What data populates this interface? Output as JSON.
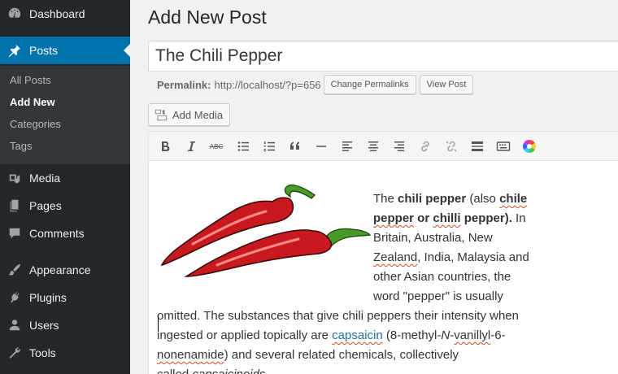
{
  "sidebar": {
    "items": [
      {
        "label": "Dashboard",
        "icon": "dashboard-icon"
      },
      {
        "label": "Posts",
        "icon": "pushpin-icon",
        "active": true
      },
      {
        "label": "Media",
        "icon": "media-icon"
      },
      {
        "label": "Pages",
        "icon": "pages-icon"
      },
      {
        "label": "Comments",
        "icon": "comments-icon"
      },
      {
        "label": "Appearance",
        "icon": "paintbrush-icon"
      },
      {
        "label": "Plugins",
        "icon": "plug-icon"
      },
      {
        "label": "Users",
        "icon": "users-icon"
      },
      {
        "label": "Tools",
        "icon": "wrench-icon"
      }
    ],
    "submenu": [
      "All Posts",
      "Add New",
      "Categories",
      "Tags"
    ],
    "current_submenu": "Add New"
  },
  "page": {
    "title": "Add New Post",
    "post_title_value": "The Chili Pepper",
    "permalink_label": "Permalink:",
    "permalink_url": "http://localhost/?p=656",
    "change_permalinks_label": "Change Permalinks",
    "view_post_label": "View Post",
    "add_media_label": "Add Media"
  },
  "toolbar": {
    "buttons": [
      "bold",
      "italic",
      "strikethrough",
      "bulleted-list",
      "numbered-list",
      "blockquote",
      "horizontal-line",
      "align-left",
      "align-center",
      "align-right",
      "insert-link",
      "remove-link",
      "read-more",
      "toolbar-toggle",
      "text-color"
    ],
    "strike_label": "ABC"
  },
  "content": {
    "image_alt": "two red chili peppers",
    "lines": [
      {
        "parts": [
          [
            "t",
            "The "
          ],
          [
            "b",
            "chili pepper"
          ],
          [
            "t",
            " (also "
          ],
          [
            "bs",
            "chile"
          ]
        ]
      },
      {
        "parts": [
          [
            "bs",
            "pepper"
          ],
          [
            "b",
            " or "
          ],
          [
            "bs",
            "chilli"
          ],
          [
            "b",
            " pepper)."
          ],
          [
            "t",
            " In"
          ]
        ]
      },
      {
        "parts": [
          [
            "t",
            "Britain, Australia, New"
          ]
        ]
      },
      {
        "parts": [
          [
            "s",
            "Zealand"
          ],
          [
            "t",
            ", India, Malaysia and"
          ]
        ]
      },
      {
        "parts": [
          [
            "t",
            "other Asian countries, the"
          ]
        ]
      },
      {
        "parts": [
          [
            "t",
            "word \"pepper\" is usually"
          ]
        ]
      },
      {
        "parts": [
          [
            "t",
            "omitted. The substances that give chili peppers their intensity when"
          ]
        ]
      },
      {
        "parts": [
          [
            "t",
            "ingested or applied topically are "
          ],
          [
            "ls",
            "capsaicin"
          ],
          [
            "t",
            " (8-methyl-"
          ],
          [
            "i",
            "N"
          ],
          [
            "t",
            "-"
          ],
          [
            "s",
            "vanillyl"
          ],
          [
            "t",
            "-6-"
          ]
        ]
      },
      {
        "parts": [
          [
            "s",
            "nonenamide"
          ],
          [
            "t",
            ") and several related chemicals, collectively"
          ]
        ]
      },
      {
        "parts": [
          [
            "t",
            "called "
          ],
          [
            "is",
            "capsaicinoids"
          ],
          [
            "t",
            "."
          ]
        ]
      }
    ]
  }
}
